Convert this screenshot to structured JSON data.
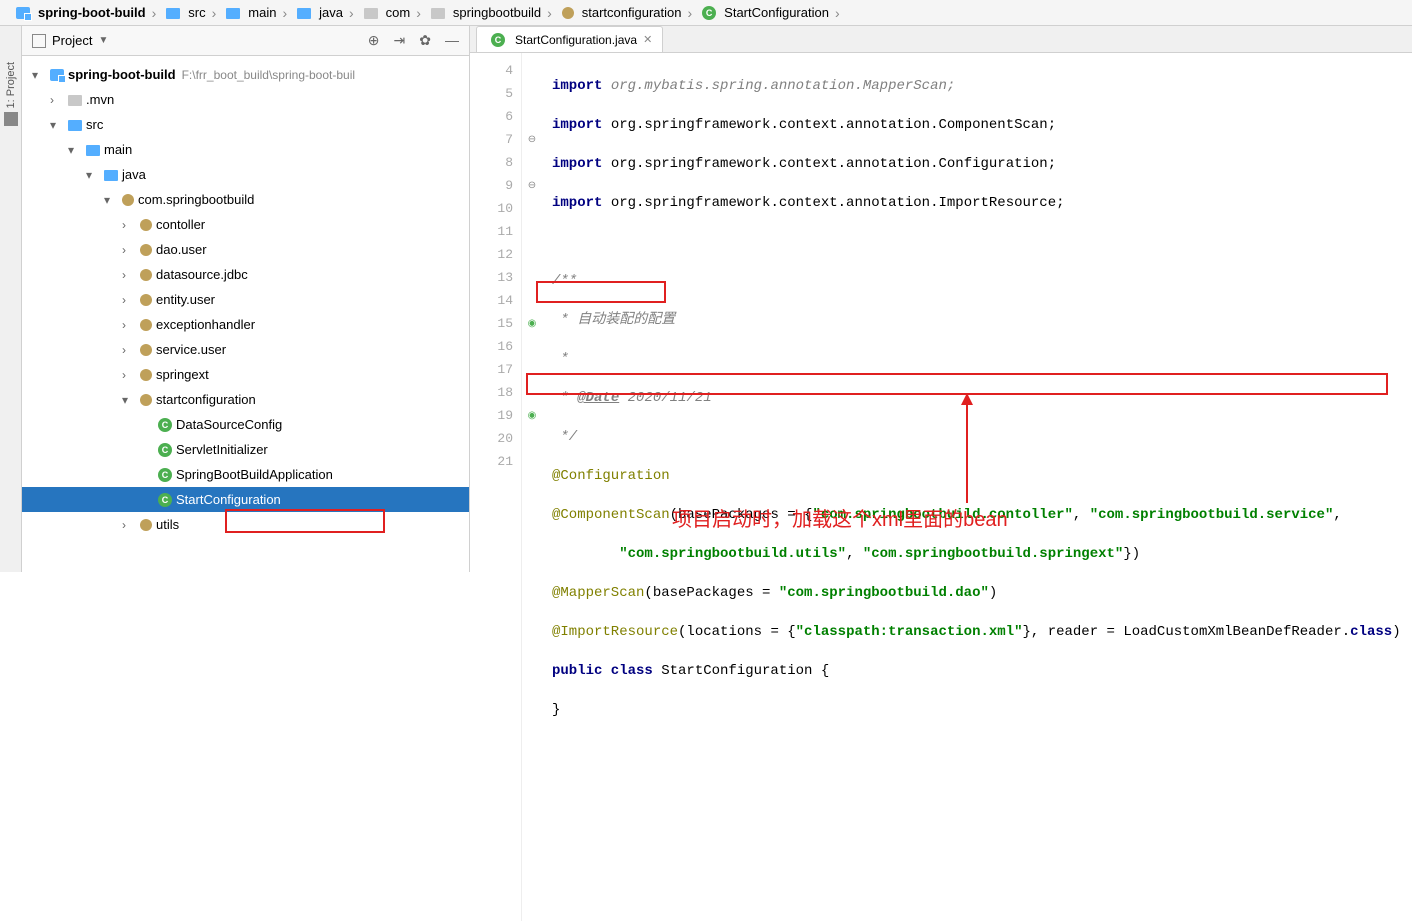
{
  "breadcrumb": [
    {
      "label": "spring-boot-build",
      "icon": "module",
      "bold": true
    },
    {
      "label": "src",
      "icon": "folder"
    },
    {
      "label": "main",
      "icon": "folder"
    },
    {
      "label": "java",
      "icon": "folder"
    },
    {
      "label": "com",
      "icon": "folder-gray"
    },
    {
      "label": "springbootbuild",
      "icon": "folder-gray"
    },
    {
      "label": "startconfiguration",
      "icon": "package"
    },
    {
      "label": "StartConfiguration",
      "icon": "class"
    }
  ],
  "project": {
    "title": "Project"
  },
  "side_tab": "1: Project",
  "tree": [
    {
      "depth": 0,
      "toggle": "▾",
      "icon": "module",
      "label": "spring-boot-build",
      "bold": true,
      "path": "F:\\frr_boot_build\\spring-boot-buil"
    },
    {
      "depth": 1,
      "toggle": "›",
      "icon": "folder-gray",
      "label": ".mvn"
    },
    {
      "depth": 1,
      "toggle": "▾",
      "icon": "folder",
      "label": "src"
    },
    {
      "depth": 2,
      "toggle": "▾",
      "icon": "folder",
      "label": "main"
    },
    {
      "depth": 3,
      "toggle": "▾",
      "icon": "folder",
      "label": "java"
    },
    {
      "depth": 4,
      "toggle": "▾",
      "icon": "package",
      "label": "com.springbootbuild"
    },
    {
      "depth": 5,
      "toggle": "›",
      "icon": "package",
      "label": "contoller"
    },
    {
      "depth": 5,
      "toggle": "›",
      "icon": "package",
      "label": "dao.user"
    },
    {
      "depth": 5,
      "toggle": "›",
      "icon": "package",
      "label": "datasource.jdbc"
    },
    {
      "depth": 5,
      "toggle": "›",
      "icon": "package",
      "label": "entity.user"
    },
    {
      "depth": 5,
      "toggle": "›",
      "icon": "package",
      "label": "exceptionhandler"
    },
    {
      "depth": 5,
      "toggle": "›",
      "icon": "package",
      "label": "service.user"
    },
    {
      "depth": 5,
      "toggle": "›",
      "icon": "package",
      "label": "springext"
    },
    {
      "depth": 5,
      "toggle": "▾",
      "icon": "package",
      "label": "startconfiguration"
    },
    {
      "depth": 6,
      "toggle": "",
      "icon": "class",
      "label": "DataSourceConfig"
    },
    {
      "depth": 6,
      "toggle": "",
      "icon": "class",
      "label": "ServletInitializer"
    },
    {
      "depth": 6,
      "toggle": "",
      "icon": "class",
      "label": "SpringBootBuildApplication"
    },
    {
      "depth": 6,
      "toggle": "",
      "icon": "class",
      "label": "StartConfiguration",
      "selected": true
    },
    {
      "depth": 5,
      "toggle": "›",
      "icon": "package",
      "label": "utils"
    }
  ],
  "tab": {
    "name": "StartConfiguration.java"
  },
  "code": {
    "line4_import": "import",
    "line4_rest": " org.mybatis.spring.annotation.",
    "line4_cls": "MapperScan",
    "line5_import": "import",
    "line5_rest": " org.springframework.context.annotation.",
    "line5_cls": "ComponentScan",
    "line6_import": "import",
    "line6_rest": " org.springframework.context.annotation.",
    "line6_cls": "Configuration",
    "line7_import": "import",
    "line7_rest": " org.springframework.context.annotation.",
    "line7_cls": "ImportResource",
    "line9": "/**",
    "line10": " * 自动装配的配置",
    "line11": " *",
    "line12_pre": " * ",
    "line12_tag": "@Date",
    "line12_post": " 2020/11/21",
    "line13": " */",
    "line14": "@Configuration",
    "line15_ann": "@ComponentScan",
    "line15_open": "(basePackages = {",
    "line15_s1": "\"com.springbootbuild.contoller\"",
    "line15_c": ", ",
    "line15_s2": "\"com.springbootbuild.service\"",
    "line15_end": ",",
    "line16_s1": "\"com.springbootbuild.utils\"",
    "line16_c": ", ",
    "line16_s2": "\"com.springbootbuild.springext\"",
    "line16_end": "})",
    "line17_ann": "@MapperScan",
    "line17_open": "(basePackages = ",
    "line17_s": "\"com.springbootbuild.dao\"",
    "line17_end": ")",
    "line18_ann": "@ImportResource",
    "line18_open": "(locations = {",
    "line18_s": "\"classpath:transaction.xml\"",
    "line18_mid": "}, reader = ",
    "line18_cls": "LoadCustomXmlBeanDefReader",
    "line18_dot": ".",
    "line18_kw": "class",
    "line18_end": ")",
    "line19_kw": "public class ",
    "line19_cls": "StartConfiguration",
    "line19_end": " {",
    "line20": "}"
  },
  "annotation": "项目启动时，加载这个xml里面的bean",
  "gutter_lines": [
    "4",
    "5",
    "6",
    "7",
    "8",
    "9",
    "10",
    "11",
    "12",
    "13",
    "14",
    "15",
    "16",
    "17",
    "18",
    "19",
    "20",
    "21"
  ]
}
